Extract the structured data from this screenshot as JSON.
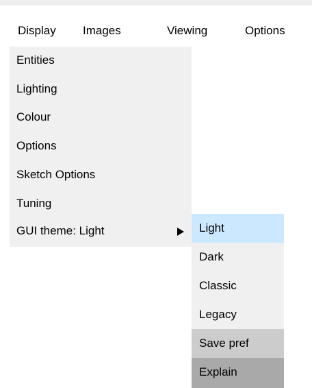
{
  "menubar": {
    "items": [
      "Display",
      "Images",
      "Viewing",
      "Options"
    ]
  },
  "display_menu": {
    "items": [
      "Entities",
      "Lighting",
      "Colour",
      "Options",
      "Sketch Options",
      "Tuning",
      "GUI theme: Light"
    ]
  },
  "theme_submenu": {
    "items": [
      "Light",
      "Dark",
      "Classic",
      "Legacy",
      "Save pref",
      "Explain"
    ],
    "selected": "Light"
  },
  "colors": {
    "selected_bg": "#cce8ff",
    "menu_bg": "#f0f0f0",
    "save_pref_bg": "#cccccc",
    "explain_bg": "#a9a9a9"
  },
  "icons": {
    "submenu_indicator": "triangle-right-icon"
  }
}
